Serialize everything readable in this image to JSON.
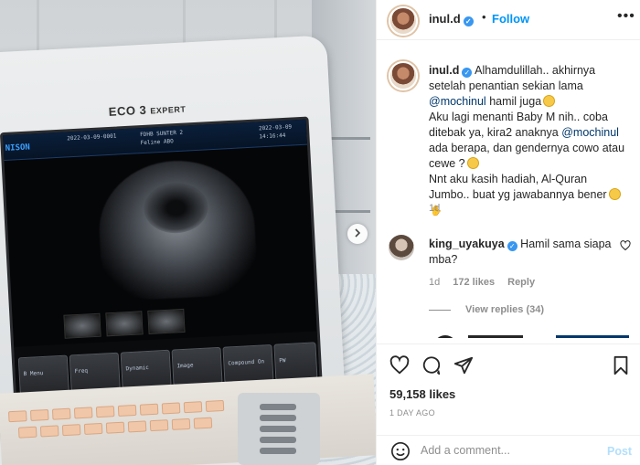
{
  "photo": {
    "brand": "ECO 3",
    "brand_sub": "EXPERT",
    "screen_brand": "NISON",
    "screen_id": "2022-03-09-0001",
    "screen_patient": "FDHB SUNTER 2",
    "screen_name": "Feline ABO",
    "screen_date": "2022-03-09",
    "screen_time": "14:16:44",
    "softkeys": [
      "B Menu",
      "Freq",
      "Dynamic",
      "Image",
      "Compound On",
      "PW"
    ]
  },
  "header": {
    "username": "inul.d",
    "follow": "Follow"
  },
  "caption": {
    "username": "inul.d",
    "text_1": "Alhamdulillah.. akhirnya setelah penantian sekian lama ",
    "mention_1": "@mochinul",
    "text_2": " hamil juga",
    "text_3": "Aku lagi menanti Baby M nih.. coba ditebak ya, kira2 anaknya ",
    "mention_2": "@mochinul",
    "text_4": " ada berapa, dan gendernya cowo atau cewe ?",
    "text_5": "Nnt aku kasih hadiah, Al-Quran Jumbo.. buat yg jawabannya bener",
    "time": "1d"
  },
  "comment": {
    "username": "king_uyakuya",
    "text": "Hamil sama siapa mba?",
    "time": "1d",
    "likes": "172 likes",
    "reply": "Reply",
    "view_replies": "View replies (34)"
  },
  "actions": {
    "icons": [
      "heart-icon",
      "comment-icon",
      "share-icon",
      "bookmark-icon"
    ]
  },
  "likes": "59,158 likes",
  "date": "1 DAY AGO",
  "add_comment": {
    "placeholder": "Add a comment...",
    "post": "Post"
  },
  "colors": {
    "link": "#0095f6",
    "mention": "#00376b",
    "muted": "#8e8e8e",
    "verified": "#3897f0"
  }
}
